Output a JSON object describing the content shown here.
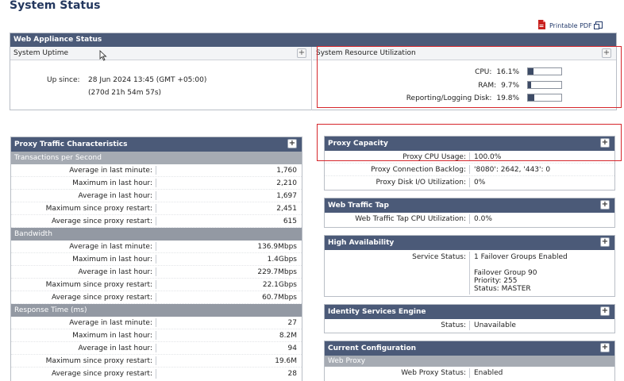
{
  "page": {
    "title": "System Status",
    "printable_pdf": "Printable PDF"
  },
  "web_appliance_status": {
    "header": "Web Appliance Status",
    "system_uptime": {
      "title": "System Uptime",
      "up_since_label": "Up since:",
      "up_since_value": "28 Jun 2024 13:45 (GMT +05:00)",
      "duration": "(270d 21h 54m 57s)"
    },
    "resource_utilization": {
      "title": "System Resource Utilization",
      "items": [
        {
          "label": "CPU:",
          "value": "16.1%",
          "fraction": 0.161
        },
        {
          "label": "RAM:",
          "value": "9.7%",
          "fraction": 0.097
        },
        {
          "label": "Reporting/Logging Disk:",
          "value": "19.8%",
          "fraction": 0.198
        }
      ]
    }
  },
  "proxy_traffic": {
    "header": "Proxy Traffic Characteristics",
    "sections": [
      {
        "title": "Transactions per Second",
        "rows": [
          {
            "label": "Average in last minute:",
            "value": "1,760"
          },
          {
            "label": "Maximum in last hour:",
            "value": "2,210"
          },
          {
            "label": "Average in last hour:",
            "value": "1,697"
          },
          {
            "label": "Maximum since proxy restart:",
            "value": "2,451"
          },
          {
            "label": "Average since proxy restart:",
            "value": "615"
          }
        ]
      },
      {
        "title": "Bandwidth",
        "rows": [
          {
            "label": "Average in last minute:",
            "value": "136.9Mbps"
          },
          {
            "label": "Maximum in last hour:",
            "value": "1.4Gbps"
          },
          {
            "label": "Average in last hour:",
            "value": "229.7Mbps"
          },
          {
            "label": "Maximum since proxy restart:",
            "value": "22.1Gbps"
          },
          {
            "label": "Average since proxy restart:",
            "value": "60.7Mbps"
          }
        ]
      },
      {
        "title": "Response Time (ms)",
        "rows": [
          {
            "label": "Average in last minute:",
            "value": "27"
          },
          {
            "label": "Maximum in last hour:",
            "value": "8.2M"
          },
          {
            "label": "Average in last hour:",
            "value": "94"
          },
          {
            "label": "Maximum since proxy restart:",
            "value": "19.6M"
          },
          {
            "label": "Average since proxy restart:",
            "value": "28"
          }
        ]
      }
    ]
  },
  "proxy_capacity": {
    "header": "Proxy Capacity",
    "rows": [
      {
        "label": "Proxy CPU Usage:",
        "value": "100.0%"
      },
      {
        "label": "Proxy Connection Backlog:",
        "value": "'8080': 2642, '443': 0"
      },
      {
        "label": "Proxy Disk I/O Utilization:",
        "value": "0%"
      }
    ]
  },
  "web_traffic_tap": {
    "header": "Web Traffic Tap",
    "rows": [
      {
        "label": "Web Traffic Tap CPU Utilization:",
        "value": "0.0%"
      }
    ]
  },
  "high_availability": {
    "header": "High Availability",
    "service_status_label": "Service Status:",
    "service_status_value": "1 Failover Groups Enabled",
    "group_name": "Failover Group 90",
    "priority": "Priority: 255",
    "status": "Status: MASTER"
  },
  "identity_services": {
    "header": "Identity Services Engine",
    "rows": [
      {
        "label": "Status:",
        "value": "Unavailable"
      }
    ]
  },
  "current_configuration": {
    "header": "Current Configuration",
    "section": "Web Proxy",
    "rows": [
      {
        "label": "Web Proxy Status:",
        "value": "Enabled"
      }
    ]
  },
  "icons": {
    "pdf": "pdf-icon",
    "popout": "popout-icon",
    "expand": "plus-icon"
  },
  "colors": {
    "panel_header": "#4b5a78",
    "section_bar": "#9399a3",
    "highlight": "#d6262b",
    "title": "#23375e"
  }
}
